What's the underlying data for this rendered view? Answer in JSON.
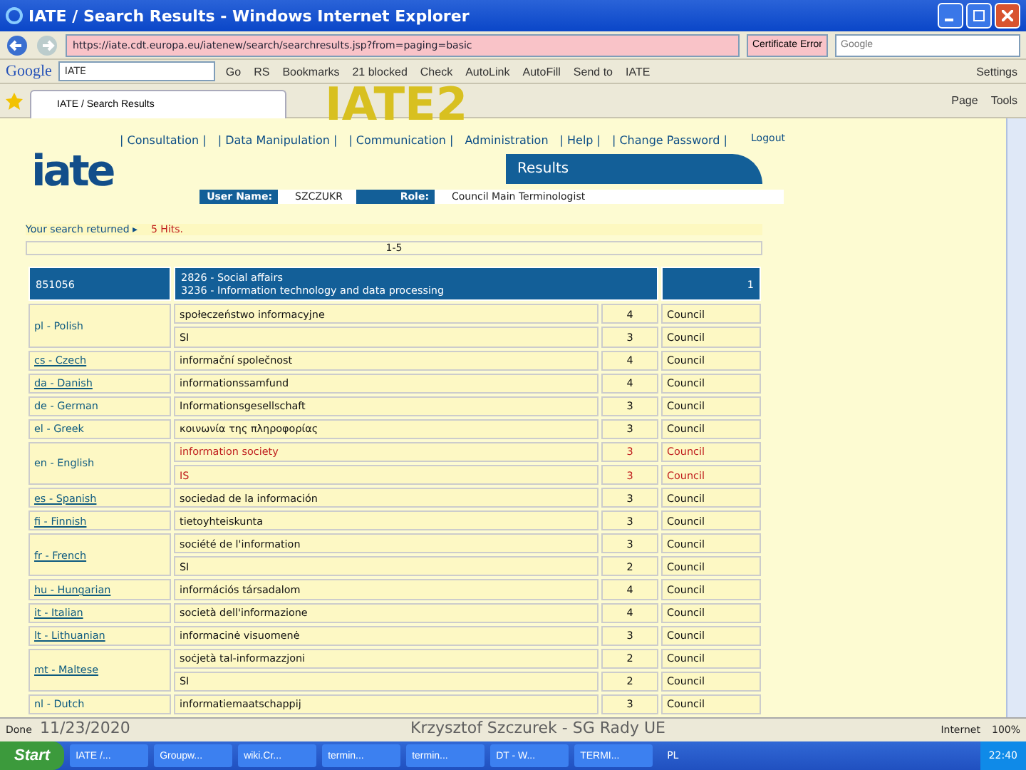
{
  "window": {
    "title": "IATE / Search Results - Windows Internet Explorer"
  },
  "address_bar": {
    "url": "https://iate.cdt.europa.eu/iatenew/search/searchresults.jsp?from=paging=basic",
    "certificate": "Certificate Error",
    "search_placeholder": "Google"
  },
  "google_toolbar": {
    "brand": "Google",
    "search_value": "IATE",
    "go": "Go",
    "items": [
      "RS",
      "Bookmarks",
      "21 blocked",
      "Check",
      "AutoLink",
      "AutoFill",
      "Send to",
      "IATE"
    ],
    "settings": "Settings"
  },
  "tabs": [
    {
      "label": "IATE / Search Results",
      "selected": true
    }
  ],
  "command_bar": [
    "Page",
    "Tools"
  ],
  "page": {
    "logo": "iate",
    "nav": [
      "| Consultation |",
      "| Data Manipulation |",
      "| Communication |",
      "Administration",
      "| Help |",
      "| Change Password |"
    ],
    "logout": "Logout",
    "banner": "Results",
    "user_label": "User Name:",
    "user": "SZCZUKR",
    "role_label": "Role:",
    "role": "Council Main Terminologist",
    "search_label": "Your search returned ▸",
    "hits": "5 Hits.",
    "paging": "1-5",
    "entry": {
      "id": "851056",
      "domains": [
        "2826 - Social affairs",
        "3236 - Information technology and data processing"
      ],
      "number": "1"
    },
    "languages": [
      {
        "language": "pl - Polish",
        "link": false,
        "terms": [
          {
            "term": "społeczeństwo informacyjne",
            "reliability": "4",
            "source": "Council",
            "highlighted": false
          },
          {
            "term": "SI",
            "reliability": "3",
            "source": "Council",
            "highlighted": false
          }
        ]
      },
      {
        "language": "cs - Czech",
        "link": true,
        "terms": [
          {
            "term": "informační společnost",
            "reliability": "4",
            "source": "Council",
            "highlighted": false
          }
        ]
      },
      {
        "language": "da - Danish",
        "link": true,
        "terms": [
          {
            "term": "informationssamfund",
            "reliability": "4",
            "source": "Council",
            "highlighted": false
          }
        ]
      },
      {
        "language": "de - German",
        "link": false,
        "terms": [
          {
            "term": "Informationsgesellschaft",
            "reliability": "3",
            "source": "Council",
            "highlighted": false
          }
        ]
      },
      {
        "language": "el - Greek",
        "link": false,
        "terms": [
          {
            "term": "κοινωνία της πληροφορίας",
            "reliability": "3",
            "source": "Council",
            "highlighted": false
          }
        ]
      },
      {
        "language": "en - English",
        "link": false,
        "terms": [
          {
            "term": "information society",
            "reliability": "3",
            "source": "Council",
            "highlighted": true
          },
          {
            "term": "IS",
            "reliability": "3",
            "source": "Council",
            "highlighted": true
          }
        ]
      },
      {
        "language": "es - Spanish",
        "link": true,
        "terms": [
          {
            "term": "sociedad de la información",
            "reliability": "3",
            "source": "Council",
            "highlighted": false
          }
        ]
      },
      {
        "language": "fi - Finnish",
        "link": true,
        "terms": [
          {
            "term": "tietoyhteiskunta",
            "reliability": "3",
            "source": "Council",
            "highlighted": false
          }
        ]
      },
      {
        "language": "fr - French",
        "link": true,
        "terms": [
          {
            "term": "société de l'information",
            "reliability": "3",
            "source": "Council",
            "highlighted": false
          },
          {
            "term": "SI",
            "reliability": "2",
            "source": "Council",
            "highlighted": false
          }
        ]
      },
      {
        "language": "hu - Hungarian",
        "link": true,
        "terms": [
          {
            "term": "információs társadalom",
            "reliability": "4",
            "source": "Council",
            "highlighted": false
          }
        ]
      },
      {
        "language": "it - Italian",
        "link": true,
        "terms": [
          {
            "term": "società dell'informazione",
            "reliability": "4",
            "source": "Council",
            "highlighted": false
          }
        ]
      },
      {
        "language": "lt - Lithuanian",
        "link": true,
        "terms": [
          {
            "term": "informacinė visuomenė",
            "reliability": "3",
            "source": "Council",
            "highlighted": false
          }
        ]
      },
      {
        "language": "mt - Maltese",
        "link": true,
        "terms": [
          {
            "term": "soċjetà tal-informazzjoni",
            "reliability": "2",
            "source": "Council",
            "highlighted": false
          },
          {
            "term": "SI",
            "reliability": "2",
            "source": "Council",
            "highlighted": false
          }
        ]
      },
      {
        "language": "nl - Dutch",
        "link": false,
        "terms": [
          {
            "term": "informatiemaatschappij",
            "reliability": "3",
            "source": "Council",
            "highlighted": false
          }
        ]
      }
    ]
  },
  "status_bar": {
    "status": "Done",
    "zone": "Internet",
    "zoom": "100%"
  },
  "taskbar": {
    "start": "Start",
    "items": [
      "IATE /...",
      "Groupw...",
      "wiki.Cr...",
      "termin...",
      "termin...",
      "DT - W...",
      "TERMI..."
    ],
    "language": "PL",
    "clock": "22:40"
  },
  "slide": {
    "title": "IATE2",
    "date": "11/23/2020",
    "footer": "Krzysztof Szczurek - SG Rady UE"
  }
}
